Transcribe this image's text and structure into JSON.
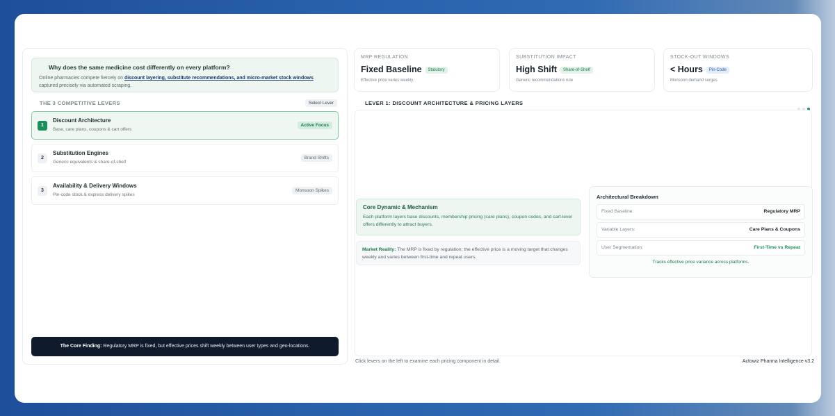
{
  "intro": {
    "question": "Why does the same medicine cost differently on every platform?",
    "text_before": "Online pharmacies compete fiercely on ",
    "highlight": "discount layering, substitute recommendations, and micro-market stock windows",
    "text_after": " captured precisely via automated scraping."
  },
  "levers": {
    "heading": "THE 3 COMPETITIVE LEVERS",
    "select_label": "Select Lever",
    "items": [
      {
        "num": "1",
        "title": "Discount Architecture",
        "subtitle": "Base, care plans, coupons & cart offers",
        "tag": "Active Focus"
      },
      {
        "num": "2",
        "title": "Substitution Engines",
        "subtitle": "Generic equivalents & share-of-shelf",
        "tag": "Brand Shifts"
      },
      {
        "num": "3",
        "title": "Availability & Delivery Windows",
        "subtitle": "Pin-code stock & express delivery spikes",
        "tag": "Monsoon Spikes"
      }
    ]
  },
  "finding": {
    "label": "The Core Finding:",
    "text": " Regulatory MRP is fixed, but effective prices shift weekly between user types and geo-locations."
  },
  "stats": [
    {
      "label": "MRP REGULATION",
      "value": "Fixed Baseline",
      "badge": "Statutory",
      "note": "Effective price varies weekly"
    },
    {
      "label": "SUBSTITUTION IMPACT",
      "value": "High Shift",
      "badge": "Share-of-Shelf",
      "note": "Generic recommendations rule"
    },
    {
      "label": "STOCK-OUT WINDOWS",
      "value": "< Hours",
      "badge": "Pin-Code",
      "note": "Monsoon demand surges"
    }
  ],
  "main": {
    "heading": "LEVER 1: DISCOUNT ARCHITECTURE & PRICING LAYERS",
    "core_title": "Core Dynamic & Mechanism",
    "core_desc": "Each platform layers base discounts, membership pricing (care plans), coupon codes, and cart-level offers differently to attract buyers.",
    "reality_label": "Market Reality:",
    "reality_text": " The MRP is fixed by regulation; the effective price is a moving target that changes weekly and varies between first-time and repeat users."
  },
  "breakdown": {
    "title": "Architectural Breakdown",
    "rows": [
      {
        "key": "Fixed Baseline:",
        "value": "Regulatory MRP"
      },
      {
        "key": "Variable Layers:",
        "value": "Care Plans & Coupons"
      },
      {
        "key": "User Segmentation:",
        "value": "First-Time vs Repeat"
      }
    ],
    "note": "Tracks effective price variance across platforms."
  },
  "footer": {
    "hint": "Click levers on the left to examine each pricing component in detail.",
    "brand": "Actowiz Pharma Intelligence v3.2"
  },
  "colors": {
    "accent": "#1b8f5a",
    "dark": "#0f1b2d",
    "background": "#2a63ad"
  }
}
